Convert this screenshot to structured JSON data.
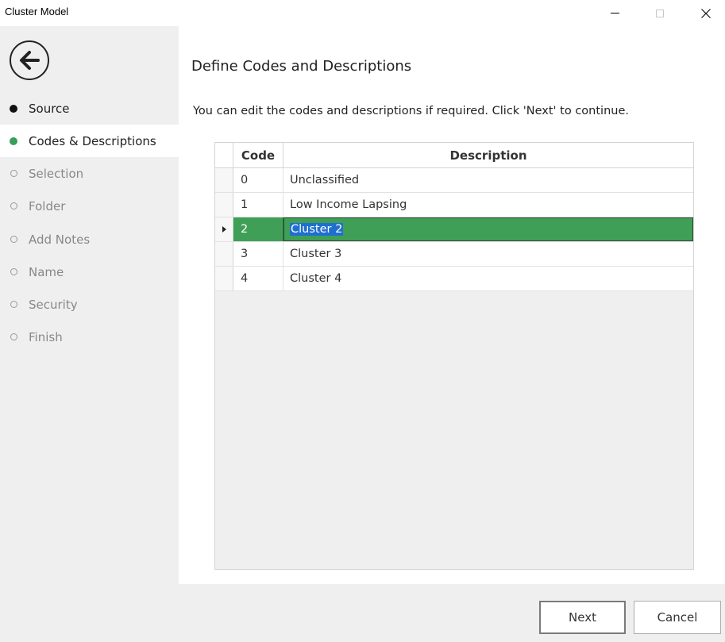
{
  "window": {
    "title": "Cluster Model"
  },
  "sidebar": {
    "steps": [
      {
        "label": "Source",
        "state": "done"
      },
      {
        "label": "Codes & Descriptions",
        "state": "active"
      },
      {
        "label": "Selection",
        "state": "pending"
      },
      {
        "label": "Folder",
        "state": "pending"
      },
      {
        "label": "Add Notes",
        "state": "pending"
      },
      {
        "label": "Name",
        "state": "pending"
      },
      {
        "label": "Security",
        "state": "pending"
      },
      {
        "label": "Finish",
        "state": "pending"
      }
    ]
  },
  "main": {
    "heading": "Define Codes and Descriptions",
    "instruction": "You can edit the codes and descriptions if required. Click 'Next' to continue."
  },
  "grid": {
    "columns": [
      "Code",
      "Description"
    ],
    "rows": [
      {
        "code": "0",
        "description": "Unclassified"
      },
      {
        "code": "1",
        "description": "Low Income Lapsing"
      },
      {
        "code": "2",
        "description": "Cluster 2"
      },
      {
        "code": "3",
        "description": "Cluster 3"
      },
      {
        "code": "4",
        "description": "Cluster 4"
      }
    ],
    "selected_row": 2
  },
  "footer": {
    "next_label": "Next",
    "cancel_label": "Cancel"
  },
  "colors": {
    "accent_green": "#3f9f56",
    "text_selection_blue": "#1f6fd1",
    "panel_gray": "#efefef"
  },
  "icons": {
    "back": "arrow-left-circle-icon",
    "minimize": "minimize-icon",
    "maximize": "maximize-icon",
    "close": "close-icon",
    "row_indicator": "triangle-right-icon"
  }
}
